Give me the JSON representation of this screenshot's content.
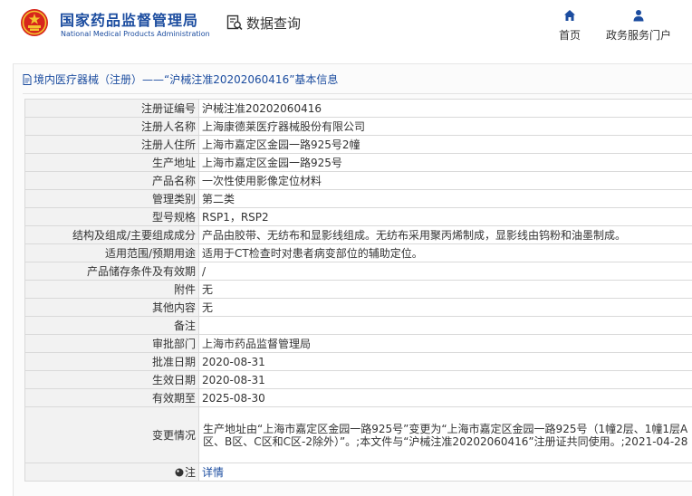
{
  "header": {
    "site_name": "国家药品监督管理局",
    "site_name_en": "National Medical Products Administration",
    "data_query": "数据查询",
    "nav": {
      "home": "首页",
      "service": "政务服务门户"
    }
  },
  "breadcrumb": "境内医疗器械（注册）——“沪械注准20202060416”基本信息",
  "rows": [
    {
      "label": "注册证编号",
      "value": "沪械注准20202060416"
    },
    {
      "label": "注册人名称",
      "value": "上海康德莱医疗器械股份有限公司"
    },
    {
      "label": "注册人住所",
      "value": "上海市嘉定区金园一路925号2幢"
    },
    {
      "label": "生产地址",
      "value": "上海市嘉定区金园一路925号"
    },
    {
      "label": "产品名称",
      "value": "一次性使用影像定位材料"
    },
    {
      "label": "管理类别",
      "value": "第二类"
    },
    {
      "label": "型号规格",
      "value": "RSP1，RSP2"
    },
    {
      "label": "结构及组成/主要组成成分",
      "value": "产品由胶带、无纺布和显影线组成。无纺布采用聚丙烯制成，显影线由钨粉和油墨制成。"
    },
    {
      "label": "适用范围/预期用途",
      "value": "适用于CT检查时对患者病变部位的辅助定位。"
    },
    {
      "label": "产品储存条件及有效期",
      "value": "/"
    },
    {
      "label": "附件",
      "value": "无"
    },
    {
      "label": "其他内容",
      "value": "无"
    },
    {
      "label": "备注",
      "value": ""
    },
    {
      "label": "审批部门",
      "value": "上海市药品监督管理局"
    },
    {
      "label": "批准日期",
      "value": "2020-08-31"
    },
    {
      "label": "生效日期",
      "value": "2020-08-31"
    },
    {
      "label": "有效期至",
      "value": "2025-08-30"
    },
    {
      "label": "变更情况",
      "value": "生产地址由“上海市嘉定区金园一路925号”变更为“上海市嘉定区金园一路925号（1幢2层、1幢1层A区、B区、C区和C区-2除外）”。;本文件与“沪械注准20202060416”注册证共同使用。;2021-04-28"
    },
    {
      "label": "注",
      "value": "详情"
    }
  ],
  "colors": {
    "brand": "#1b4c9f",
    "emblem_red": "#d7261c",
    "emblem_gold": "#f3c52f"
  },
  "icons": [
    "national-emblem-icon",
    "data-query-icon",
    "home-icon",
    "user-icon",
    "document-icon",
    "note-icon"
  ]
}
